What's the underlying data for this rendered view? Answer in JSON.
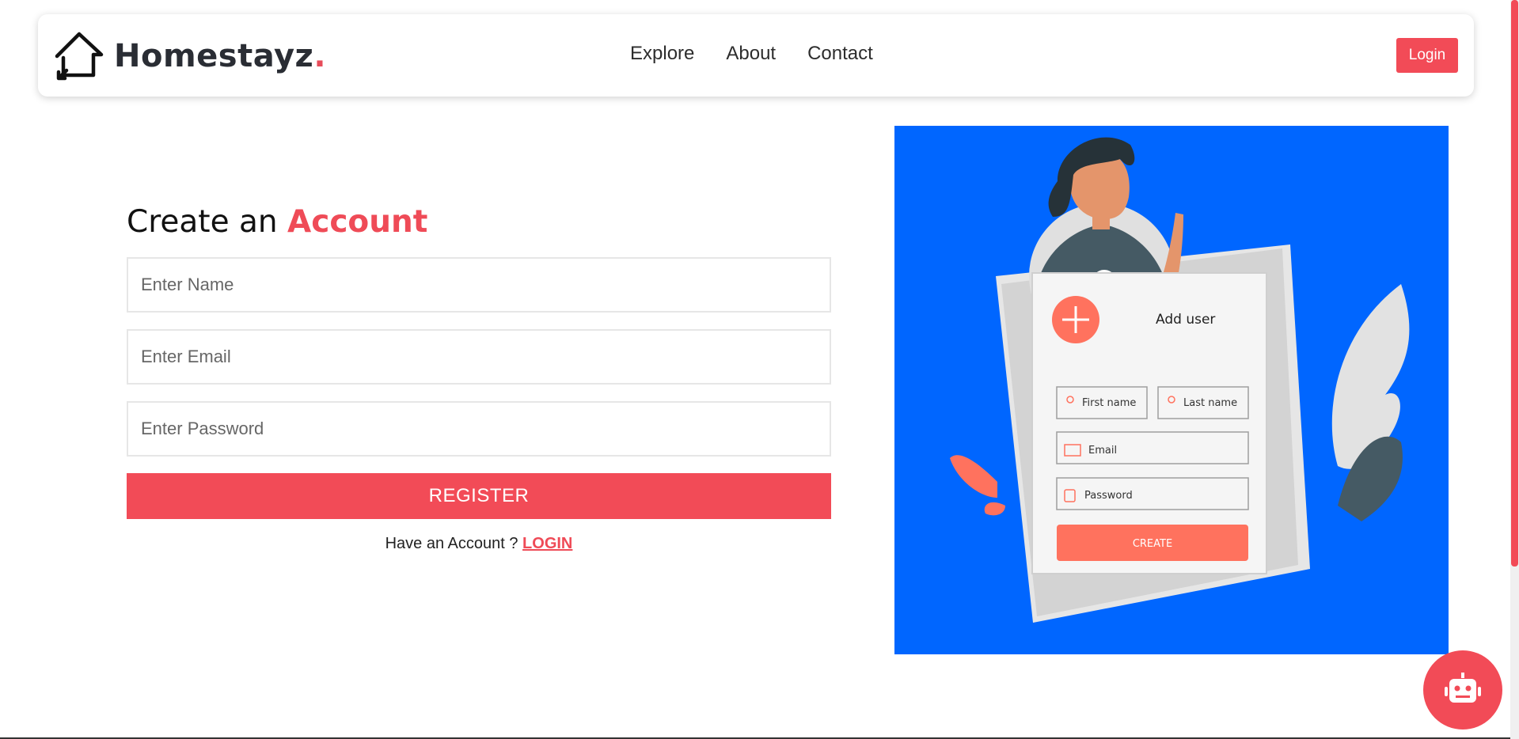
{
  "nav": {
    "brand_name": "Homestayz",
    "brand_dot": ".",
    "links": [
      "Explore",
      "About",
      "Contact"
    ],
    "login_label": "Login"
  },
  "form": {
    "title_prefix": "Create an",
    "title_accent": "Account",
    "name_placeholder": "Enter Name",
    "email_placeholder": "Enter Email",
    "password_placeholder": "Enter Password",
    "register_label": "REGISTER",
    "have_account_text": "Have an Account ?",
    "login_link": "LOGIN"
  },
  "illustration": {
    "card_title": "Add user",
    "first_name": "First name",
    "last_name": "Last name",
    "email": "Email",
    "password": "Password",
    "create_label": "CREATE"
  },
  "colors": {
    "accent": "#f24b57",
    "illustration_bg": "#0066ff"
  },
  "icons": {
    "brand": "house-outline-icon",
    "chatbot": "robot-icon"
  }
}
